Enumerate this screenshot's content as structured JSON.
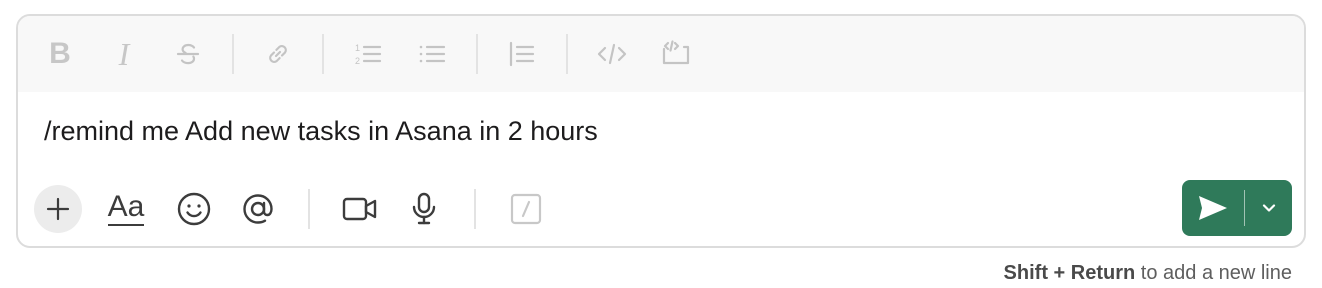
{
  "formatting_toolbar": {
    "bold_label": "B",
    "italic_label": "I",
    "items": [
      "bold-icon",
      "italic-icon",
      "strikethrough-icon",
      "link-icon",
      "ordered-list-icon",
      "bulleted-list-icon",
      "blockquote-icon",
      "code-icon",
      "code-block-icon"
    ]
  },
  "editor": {
    "text": "/remind me Add new tasks in Asana in 2 hours"
  },
  "bottom_toolbar": {
    "format_label": "Aa",
    "items": [
      "plus-icon",
      "text-format-icon",
      "emoji-icon",
      "mention-icon",
      "video-icon",
      "microphone-icon",
      "slash-command-icon"
    ]
  },
  "send": {
    "accent_color": "#2f7a5a"
  },
  "hint": {
    "shortcut": "Shift + Return",
    "rest": " to add a new line"
  }
}
